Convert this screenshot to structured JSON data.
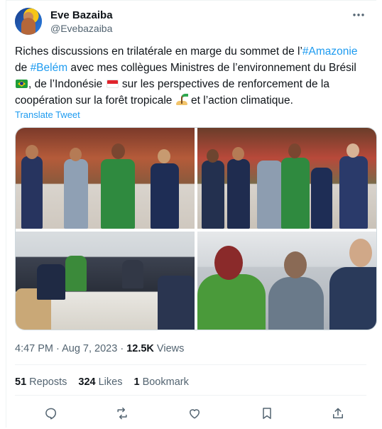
{
  "author": {
    "name": "Eve Bazaiba",
    "handle": "@Evebazaiba"
  },
  "tweet": {
    "t1": "Riches discussions en trilatérale en marge du sommet de l’",
    "hashtag1": "#Amazonie",
    "t2": " de ",
    "hashtag2": "#Belém",
    "t3": " avec mes collègues Ministres de l’environnement du Brésil ",
    "t4": ", de l’Indonésie ",
    "t5": " sur les perspectives de renforcement de la coopération sur la forêt tropicale ",
    "t6": " et l’action climatique.",
    "translate_label": "Translate Tweet"
  },
  "meta": {
    "time": "4:47 PM",
    "sep1": " · ",
    "date": "Aug 7, 2023",
    "sep2": " · ",
    "views_count": "12.5K",
    "views_label": " Views"
  },
  "stats": {
    "reposts_count": "51",
    "reposts_label": " Reposts",
    "likes_count": "324",
    "likes_label": " Likes",
    "bookmarks_count": "1",
    "bookmarks_label": " Bookmark"
  },
  "icons": {
    "reply": "reply-icon",
    "repost": "repost-icon",
    "like": "like-icon",
    "bookmark": "bookmark-icon",
    "share": "share-icon",
    "more": "more-icon",
    "flag_brazil": "brazil-flag-icon",
    "flag_indonesia": "indonesia-flag-icon",
    "island": "desert-island-icon"
  },
  "colors": {
    "link": "#1d9bf0",
    "secondary_text": "#536471",
    "primary_text": "#0f1419"
  }
}
